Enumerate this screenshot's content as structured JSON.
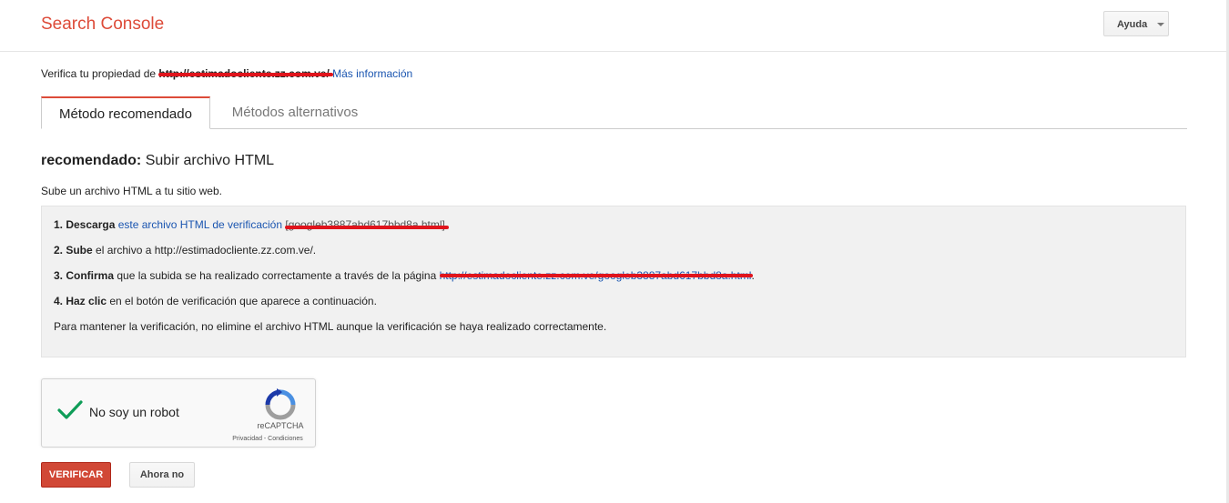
{
  "app": {
    "title": "Search Console"
  },
  "header": {
    "help_label": "Ayuda"
  },
  "verify": {
    "prefix": "Verifica tu propiedad de ",
    "property_url": "http://estimadocliente.zz.com.ve/",
    "more_info": "Más información"
  },
  "tabs": [
    {
      "label": "Método recomendado",
      "active": true
    },
    {
      "label": "Métodos alternativos",
      "active": false
    }
  ],
  "method": {
    "title_bold": "recomendado:",
    "title_rest": " Subir archivo HTML",
    "description": "Sube un archivo HTML a tu sitio web."
  },
  "steps": {
    "s1_bold": "1. Descarga",
    "s1_link": "este archivo HTML de verificación",
    "s1_file": "[googleb3887abd617bbd8a.html]",
    "s1_end": ".",
    "s2_bold": "2. Sube",
    "s2_text": " el archivo a http://estimadocliente.zz.com.ve/.",
    "s3_bold": "3. Confirma",
    "s3_text": " que la subida se ha realizado correctamente a través de la página ",
    "s3_link": "http://estimadocliente.zz.com.ve/googleb3887abd617bbd8a.html",
    "s3_end": ".",
    "s4_bold": "4. Haz clic",
    "s4_text": " en el botón de verificación que aparece a continuación.",
    "note": "Para mantener la verificación, no elimine el archivo HTML aunque la verificación se haya realizado correctamente."
  },
  "captcha": {
    "label": "No soy un robot",
    "brand": "reCAPTCHA",
    "links": "Privacidad - Condiciones",
    "checked": true
  },
  "actions": {
    "verify": "VERIFICAR",
    "later": "Ahora no"
  },
  "colors": {
    "brand_red": "#dd4b39",
    "link_blue": "#1a55b0",
    "verify_button": "#d14836",
    "redaction": "#e0141c",
    "check_green": "#0f9d58"
  },
  "icons": {
    "help_caret": "chevron-down-icon",
    "checkmark": "checkmark-icon",
    "recaptcha": "recaptcha-logo-icon"
  }
}
